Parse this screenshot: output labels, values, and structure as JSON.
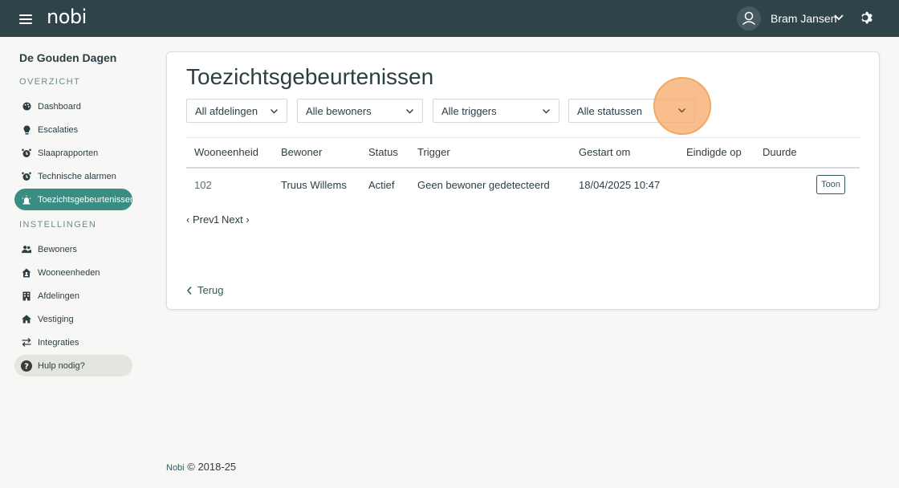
{
  "header": {
    "logo": "nobi",
    "user_name": "Bram Jansen",
    "colors": {
      "bar": "#2f4449",
      "accent": "#3a8d83"
    }
  },
  "sidebar": {
    "org_name": "De Gouden Dagen",
    "sections": {
      "overview": "OVERZICHT",
      "settings": "INSTELLINGEN"
    },
    "overview_items": [
      {
        "label": "Dashboard",
        "icon": "palette-icon"
      },
      {
        "label": "Escalaties",
        "icon": "lightbulb-icon"
      },
      {
        "label": "Slaaprapporten",
        "icon": "alarm-clock-icon"
      },
      {
        "label": "Technische alarmen",
        "icon": "alarm-clock-icon"
      },
      {
        "label": "Toezichtsgebeurtenissen",
        "icon": "siren-icon",
        "active": true
      }
    ],
    "settings_items": [
      {
        "label": "Bewoners",
        "icon": "users-icon"
      },
      {
        "label": "Wooneenheden",
        "icon": "house-user-icon"
      },
      {
        "label": "Afdelingen",
        "icon": "building-icon"
      },
      {
        "label": "Vestiging",
        "icon": "home-icon"
      },
      {
        "label": "Integraties",
        "icon": "arrows-exchange-icon"
      },
      {
        "label": "Hulp nodig?",
        "icon": "question-circle-icon"
      }
    ]
  },
  "main": {
    "title": "Toezichtsgebeurtenissen",
    "filters": {
      "department": "All afdelingen",
      "residents": "Alle bewoners",
      "triggers": "Alle triggers",
      "statuses": "Alle statussen"
    },
    "table": {
      "columns": [
        "Wooneenheid",
        "Bewoner",
        "Status",
        "Trigger",
        "Gestart om",
        "Eindigde op",
        "Duurde"
      ],
      "rows": [
        {
          "unit": "102",
          "resident": "Truus Willems",
          "status": "Actief",
          "trigger": "Geen bewoner gedetecteerd",
          "started": "18/04/2025 10:47",
          "ended": "",
          "duration": "",
          "action": "Toon"
        }
      ]
    },
    "pager": {
      "prev": "‹ Prev",
      "page": "1",
      "next": "Next ›"
    },
    "back": "Terug"
  },
  "footer": {
    "brand": "Nobi",
    "copyright": "© 2018-25"
  }
}
